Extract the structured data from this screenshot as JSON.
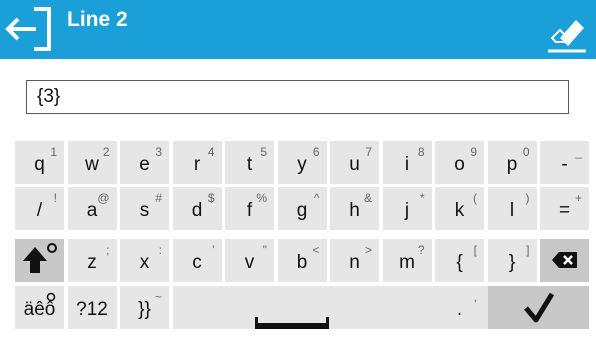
{
  "window": {
    "title": "Line 2",
    "back_icon": "back-arrow-icon",
    "clear_icon": "eraser-icon",
    "header_color": "#1b9fd8"
  },
  "input": {
    "value": "{3}"
  },
  "keyboard": {
    "rows": [
      [
        {
          "main": "q",
          "sec": "1"
        },
        {
          "main": "w",
          "sec": "2"
        },
        {
          "main": "e",
          "sec": "3"
        },
        {
          "main": "r",
          "sec": "4"
        },
        {
          "main": "t",
          "sec": "5"
        },
        {
          "main": "y",
          "sec": "6"
        },
        {
          "main": "u",
          "sec": "7"
        },
        {
          "main": "i",
          "sec": "8"
        },
        {
          "main": "o",
          "sec": "9"
        },
        {
          "main": "p",
          "sec": "0"
        },
        {
          "main": "-",
          "sec": "_"
        }
      ],
      [
        {
          "main": "/",
          "sec": "!"
        },
        {
          "main": "a",
          "sec": "@"
        },
        {
          "main": "s",
          "sec": "#"
        },
        {
          "main": "d",
          "sec": "$"
        },
        {
          "main": "f",
          "sec": "%"
        },
        {
          "main": "g",
          "sec": "^"
        },
        {
          "main": "h",
          "sec": "&"
        },
        {
          "main": "j",
          "sec": "*"
        },
        {
          "main": "k",
          "sec": "("
        },
        {
          "main": "l",
          "sec": ")"
        },
        {
          "main": "=",
          "sec": "+"
        }
      ],
      [
        {
          "main": "z",
          "sec": ";"
        },
        {
          "main": "x",
          "sec": ":"
        },
        {
          "main": "c",
          "sec": "'"
        },
        {
          "main": "v",
          "sec": "\""
        },
        {
          "main": "b",
          "sec": "<"
        },
        {
          "main": "n",
          "sec": ">"
        },
        {
          "main": "m",
          "sec": "?"
        },
        {
          "main": "{",
          "sec": "["
        },
        {
          "main": "}",
          "sec": "]"
        }
      ]
    ],
    "shift_icon": "shift-up-icon",
    "backspace_icon": "backspace-icon",
    "accent_label": "äêô",
    "numbers_label": "?12",
    "brace_label": "}}",
    "brace_sec": "~",
    "period_label": ".",
    "period_sec": ",",
    "enter_icon": "checkmark-icon"
  }
}
